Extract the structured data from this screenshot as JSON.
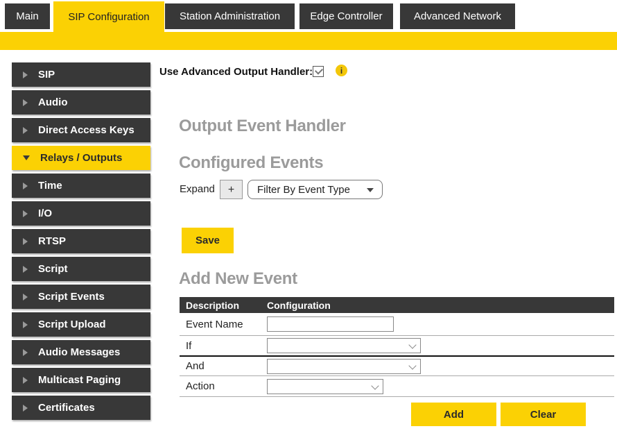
{
  "tabs": [
    {
      "label": "Main",
      "active": false
    },
    {
      "label": "SIP Configuration",
      "active": true
    },
    {
      "label": "Station Administration",
      "active": false
    },
    {
      "label": "Edge Controller",
      "active": false
    },
    {
      "label": "Advanced Network",
      "active": false
    }
  ],
  "sidebar": {
    "items": [
      {
        "label": "SIP",
        "active": false
      },
      {
        "label": "Audio",
        "active": false
      },
      {
        "label": "Direct Access Keys",
        "active": false
      },
      {
        "label": "Relays / Outputs",
        "active": true
      },
      {
        "label": "Time",
        "active": false
      },
      {
        "label": "I/O",
        "active": false
      },
      {
        "label": "RTSP",
        "active": false
      },
      {
        "label": "Script",
        "active": false
      },
      {
        "label": "Script Events",
        "active": false
      },
      {
        "label": "Script Upload",
        "active": false
      },
      {
        "label": "Audio Messages",
        "active": false
      },
      {
        "label": "Multicast Paging",
        "active": false
      },
      {
        "label": "Certificates",
        "active": false
      }
    ]
  },
  "content": {
    "advanced_handler": {
      "label": "Use Advanced Output Handler:",
      "checked": true,
      "info_icon_glyph": "i"
    },
    "output_event_handler_title": "Output Event Handler",
    "configured_events": {
      "title": "Configured Events",
      "expand_label": "Expand",
      "expand_button_label": "+",
      "filter_dropdown_selected": "Filter By Event Type"
    },
    "save_button_label": "Save",
    "add_new_event": {
      "title": "Add New Event",
      "table": {
        "headers": [
          "Description",
          "Configuration"
        ],
        "rows": [
          {
            "label": "Event Name",
            "control": "text-input",
            "value": ""
          },
          {
            "label": "If",
            "control": "select",
            "value": ""
          },
          {
            "label": "And",
            "control": "select",
            "value": ""
          },
          {
            "label": "Action",
            "control": "select",
            "value": ""
          }
        ]
      },
      "add_button_label": "Add",
      "clear_button_label": "Clear"
    }
  },
  "colors": {
    "accent_yellow": "#FBD104",
    "dark_gray": "#383838",
    "heading_gray": "#9B9B9B"
  }
}
